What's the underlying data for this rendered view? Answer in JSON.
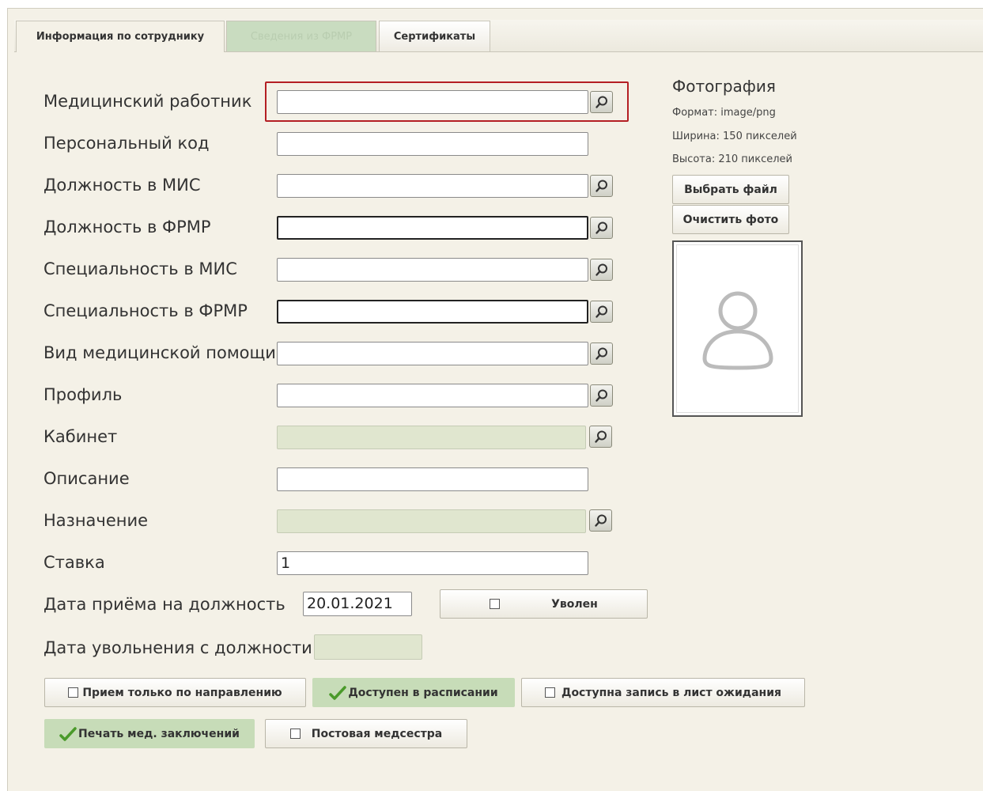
{
  "tabs": [
    {
      "label": "Информация по сотруднику",
      "state": "active"
    },
    {
      "label": "Сведения из ФРМР",
      "state": "disabled"
    },
    {
      "label": "Сертификаты",
      "state": "normal"
    }
  ],
  "fields": {
    "med_worker": {
      "label": "Медицинский работник",
      "value": ""
    },
    "personal_code": {
      "label": "Персональный код",
      "value": ""
    },
    "position_mis": {
      "label": "Должность в МИС",
      "value": ""
    },
    "position_frmr": {
      "label": "Должность в ФРМР",
      "value": ""
    },
    "specialty_mis": {
      "label": "Специальность в МИС",
      "value": ""
    },
    "specialty_frmr": {
      "label": "Специальность в ФРМР",
      "value": ""
    },
    "care_type": {
      "label": "Вид медицинской помощи",
      "value": ""
    },
    "profile": {
      "label": "Профиль",
      "value": ""
    },
    "cabinet": {
      "label": "Кабинет",
      "value": ""
    },
    "description": {
      "label": "Описание",
      "value": ""
    },
    "assignment": {
      "label": "Назначение",
      "value": ""
    },
    "rate": {
      "label": "Ставка",
      "value": "1"
    },
    "hire_date": {
      "label": "Дата приёма на должность",
      "value": "20.01.2021"
    },
    "dismissal_date": {
      "label": "Дата увольнения с должности",
      "value": ""
    }
  },
  "dismissed_label": "Уволен",
  "photo": {
    "title": "Фотография",
    "format": "Формат: image/png",
    "width": "Ширина: 150 пикселей",
    "height": "Высота: 210 пикселей",
    "choose_file": "Выбрать файл",
    "clear_photo": "Очистить фото"
  },
  "options": {
    "referral_only": "Прием только по направлению",
    "in_schedule": "Доступен в расписании",
    "waiting_list": "Доступна запись в лист ожидания",
    "print_conclusions": "Печать мед. заключений",
    "ward_nurse": "Постовая медсестра"
  },
  "colors": {
    "background": "#f4f1e7",
    "highlight_border": "#b41f24",
    "active_green": "#c7dcb8",
    "disabled_field": "#e0e6cf"
  },
  "icons": [
    "search-icon",
    "checkmark-icon",
    "user-silhouette-icon"
  ]
}
